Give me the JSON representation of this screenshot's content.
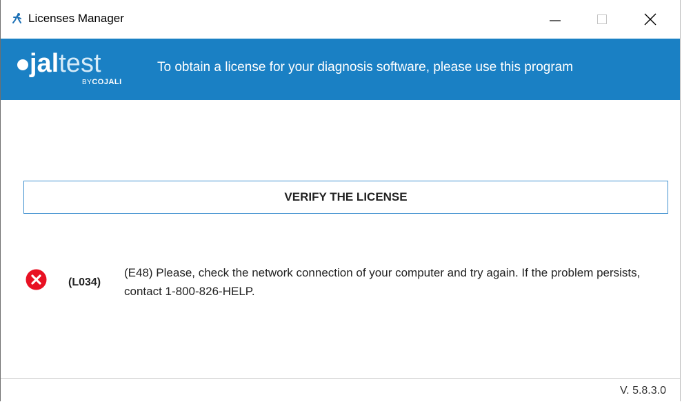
{
  "window": {
    "title": "Licenses Manager",
    "icon": "runner-icon"
  },
  "header": {
    "logo": {
      "bold": "jal",
      "light": "test",
      "by": "BY",
      "brand": "COJALI"
    },
    "text": "To obtain a license for your diagnosis software, please use this program",
    "background_color": "#1a80c4"
  },
  "main": {
    "verify_button_label": "VERIFY THE LICENSE",
    "error": {
      "icon": "error-x-icon",
      "code": "(L034)",
      "message": "(E48) Please, check the network connection of your computer and try again. If the problem persists, contact 1-800-826-HELP.",
      "icon_color": "#e81123"
    }
  },
  "footer": {
    "version": "V. 5.8.3.0"
  }
}
